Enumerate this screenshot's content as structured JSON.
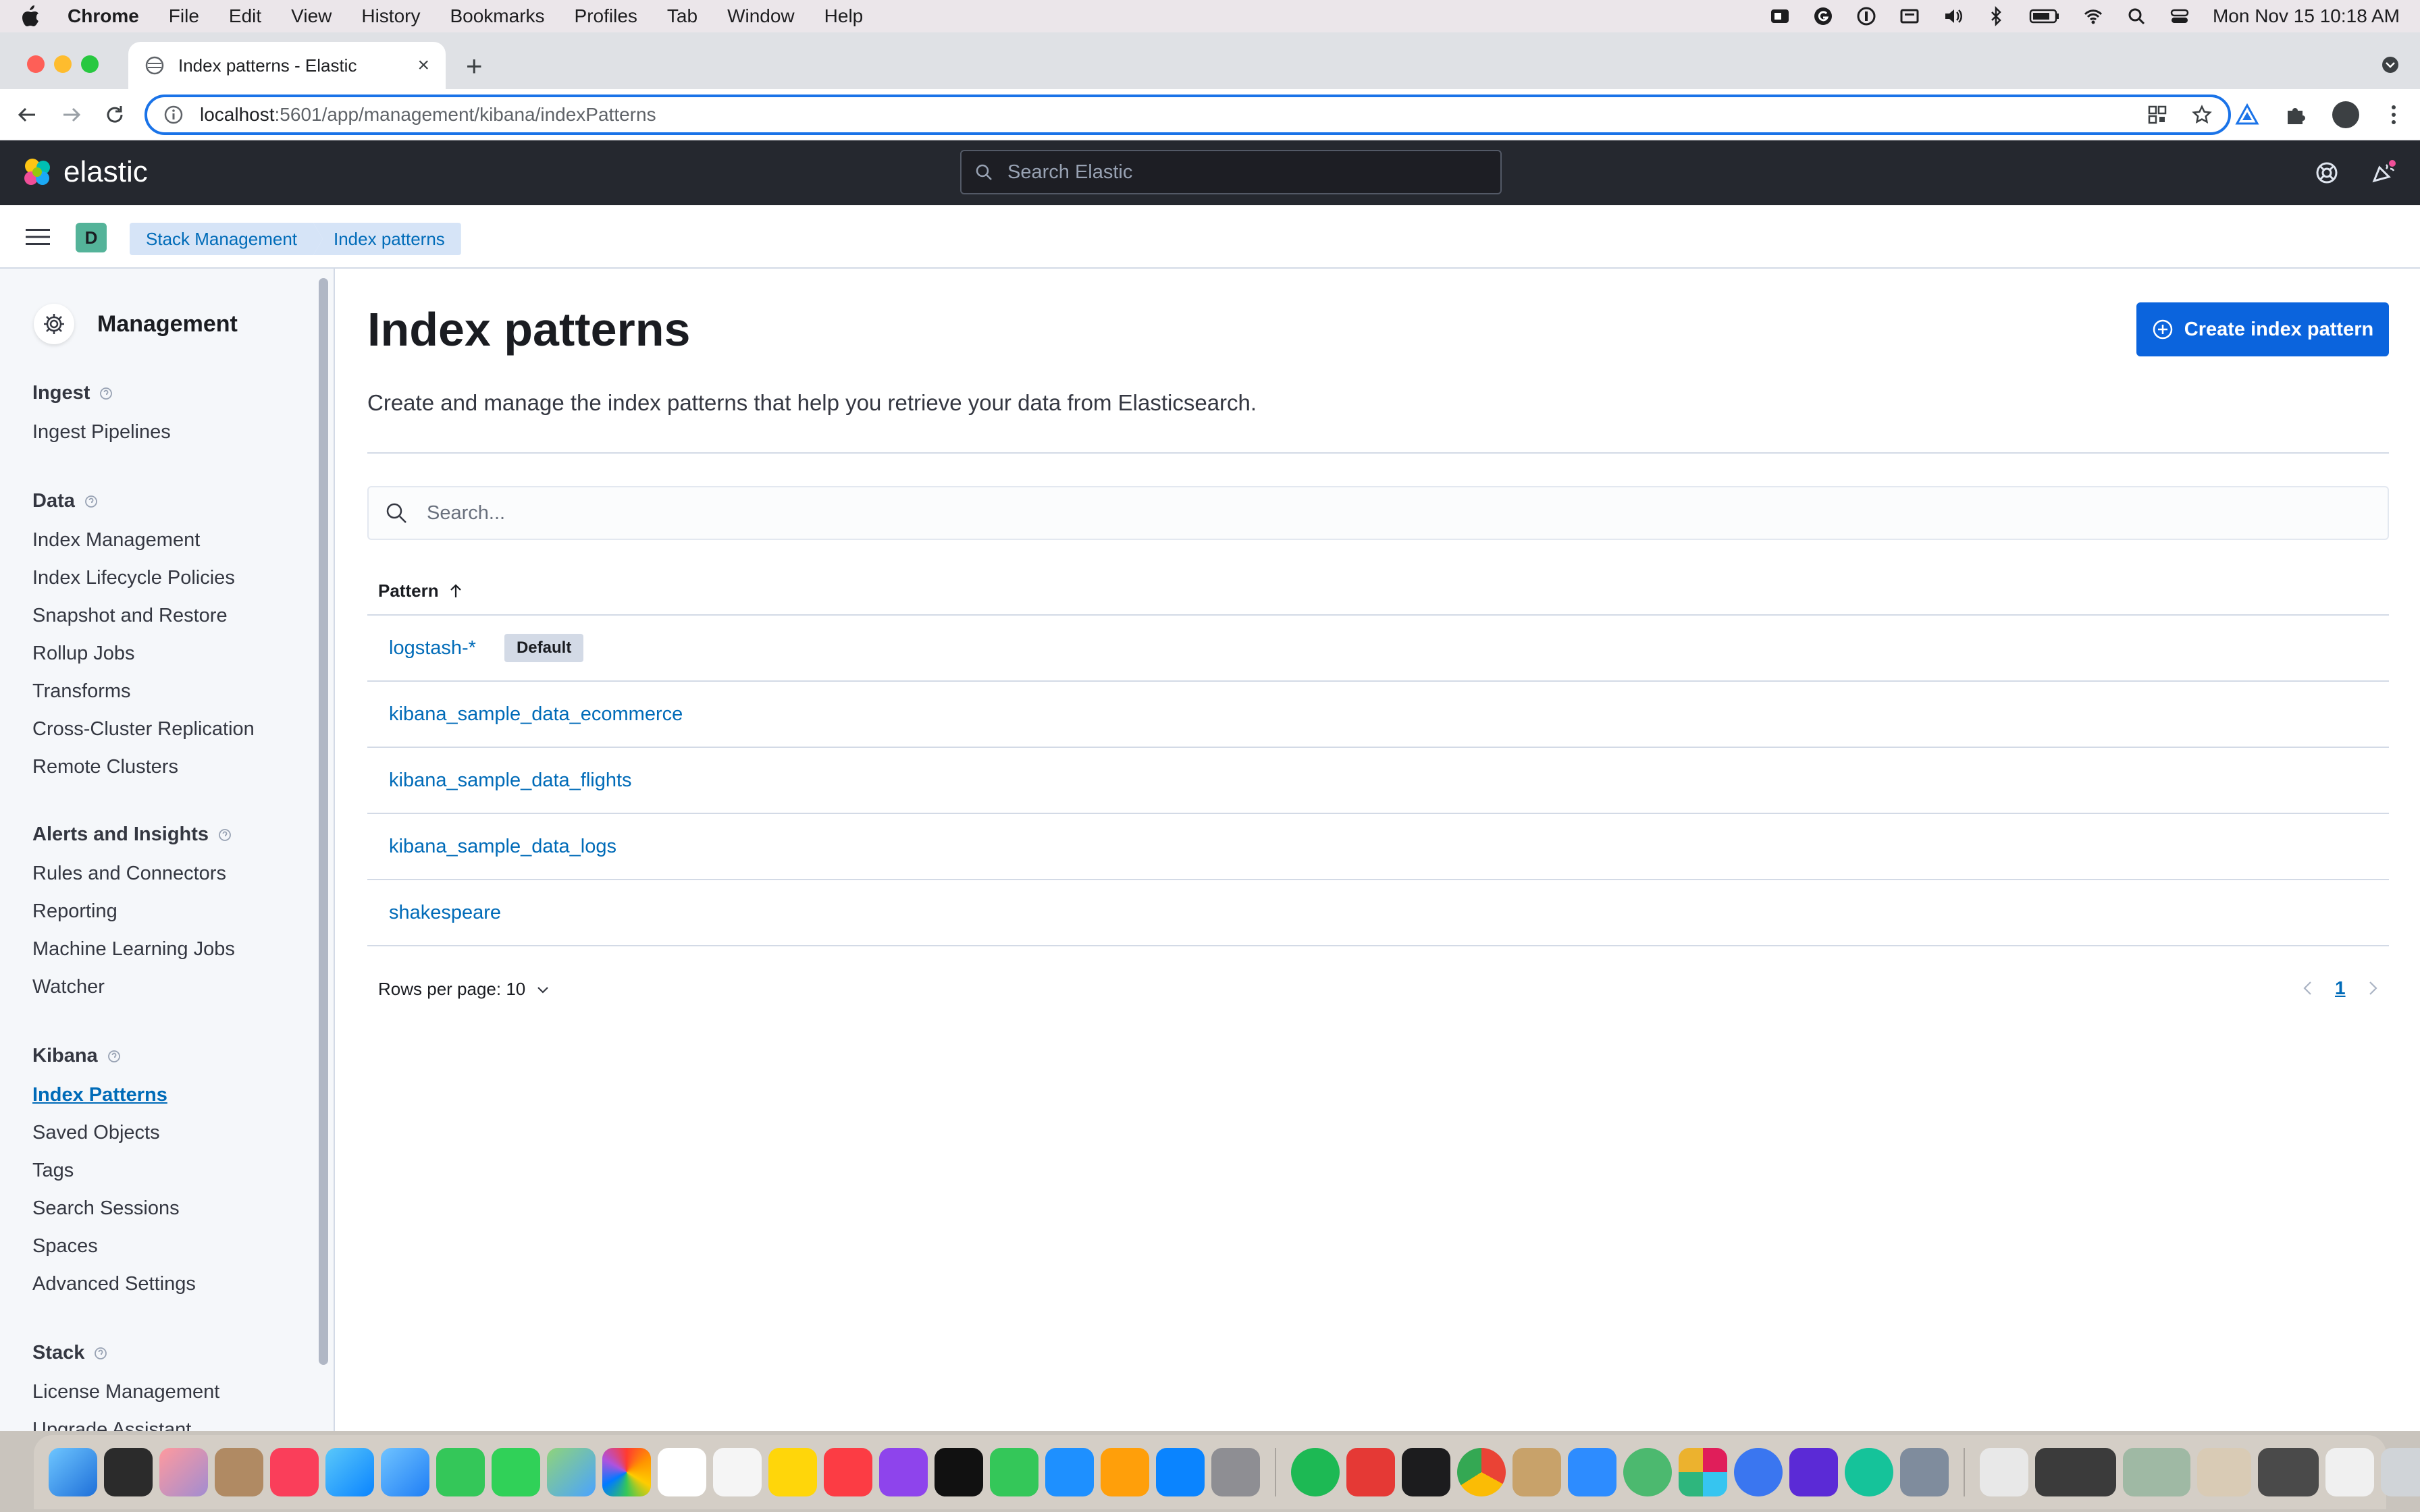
{
  "menubar": {
    "app": "Chrome",
    "items": [
      "File",
      "Edit",
      "View",
      "History",
      "Bookmarks",
      "Profiles",
      "Tab",
      "Window",
      "Help"
    ],
    "clock": "Mon Nov 15  10:18 AM"
  },
  "browser": {
    "tab_title": "Index patterns - Elastic",
    "url_host": "localhost",
    "url_path": ":5601/app/management/kibana/indexPatterns"
  },
  "kibana": {
    "logo_text": "elastic",
    "search_placeholder": "Search Elastic",
    "space_initial": "D",
    "breadcrumbs": [
      "Stack Management",
      "Index patterns"
    ]
  },
  "sidebar": {
    "title": "Management",
    "sections": [
      {
        "title": "Ingest",
        "items": [
          "Ingest Pipelines"
        ]
      },
      {
        "title": "Data",
        "items": [
          "Index Management",
          "Index Lifecycle Policies",
          "Snapshot and Restore",
          "Rollup Jobs",
          "Transforms",
          "Cross-Cluster Replication",
          "Remote Clusters"
        ]
      },
      {
        "title": "Alerts and Insights",
        "items": [
          "Rules and Connectors",
          "Reporting",
          "Machine Learning Jobs",
          "Watcher"
        ]
      },
      {
        "title": "Kibana",
        "items": [
          "Index Patterns",
          "Saved Objects",
          "Tags",
          "Search Sessions",
          "Spaces",
          "Advanced Settings"
        ]
      },
      {
        "title": "Stack",
        "items": [
          "License Management",
          "Upgrade Assistant"
        ]
      }
    ],
    "active_item": "Index Patterns"
  },
  "main": {
    "title": "Index patterns",
    "create_button": "Create index pattern",
    "description": "Create and manage the index patterns that help you retrieve your data from Elasticsearch.",
    "search_placeholder": "Search...",
    "column_header": "Pattern",
    "rows": [
      {
        "name": "logstash-*",
        "badge": "Default"
      },
      {
        "name": "kibana_sample_data_ecommerce",
        "badge": ""
      },
      {
        "name": "kibana_sample_data_flights",
        "badge": ""
      },
      {
        "name": "kibana_sample_data_logs",
        "badge": ""
      },
      {
        "name": "shakespeare",
        "badge": ""
      }
    ],
    "rows_per_page": "Rows per page: 10",
    "current_page": "1"
  },
  "colors": {
    "kibana_header": "#25282f",
    "link_blue": "#006bb8",
    "primary_button": "#0b64dd",
    "sidebar_bg": "#f5f7fa"
  }
}
